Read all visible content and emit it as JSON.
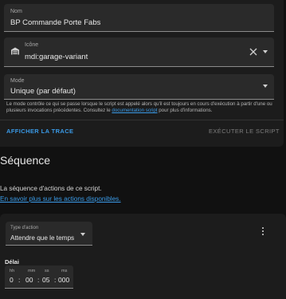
{
  "script_settings": {
    "name": {
      "label": "Nom",
      "value": "BP Commande Porte Fabs"
    },
    "icon": {
      "label": "Icône",
      "value": "mdi:garage-variant",
      "icon_name": "garage-variant-icon"
    },
    "mode": {
      "label": "Mode",
      "value": "Unique (par défaut)"
    },
    "helper": {
      "text_before": "Le mode contrôle ce qui se passe lorsque le script est appelé alors qu'il est toujours en cours d'exécution à partir d'une ou plusieurs invocations précédentes. Consultez le ",
      "link_text": "documentation script",
      "text_after": " pour plus d'informations."
    },
    "actions": {
      "show_trace": "AFFICHER LA TRACE",
      "run_script": "EXÉCUTER LE SCRIPT"
    }
  },
  "sequence": {
    "title": "Séquence",
    "description": "La séquence d'actions de ce script.",
    "learn_more": "En savoir plus sur les actions disponibles."
  },
  "action_card": {
    "type_label": "Type d'action",
    "type_value": "Attendre que le temps",
    "delay_label": "Délai",
    "duration": {
      "hh_label": "hh",
      "hh": "0",
      "mm_label": "mm",
      "mm": "00",
      "ss_label": "ss",
      "ss": "05",
      "ms_label": "ms",
      "ms": "000",
      "separator": ":"
    }
  },
  "colors": {
    "accent": "#3a9be8",
    "background": "#111111",
    "card": "#1c1c1c",
    "field": "#2a2a2a"
  }
}
